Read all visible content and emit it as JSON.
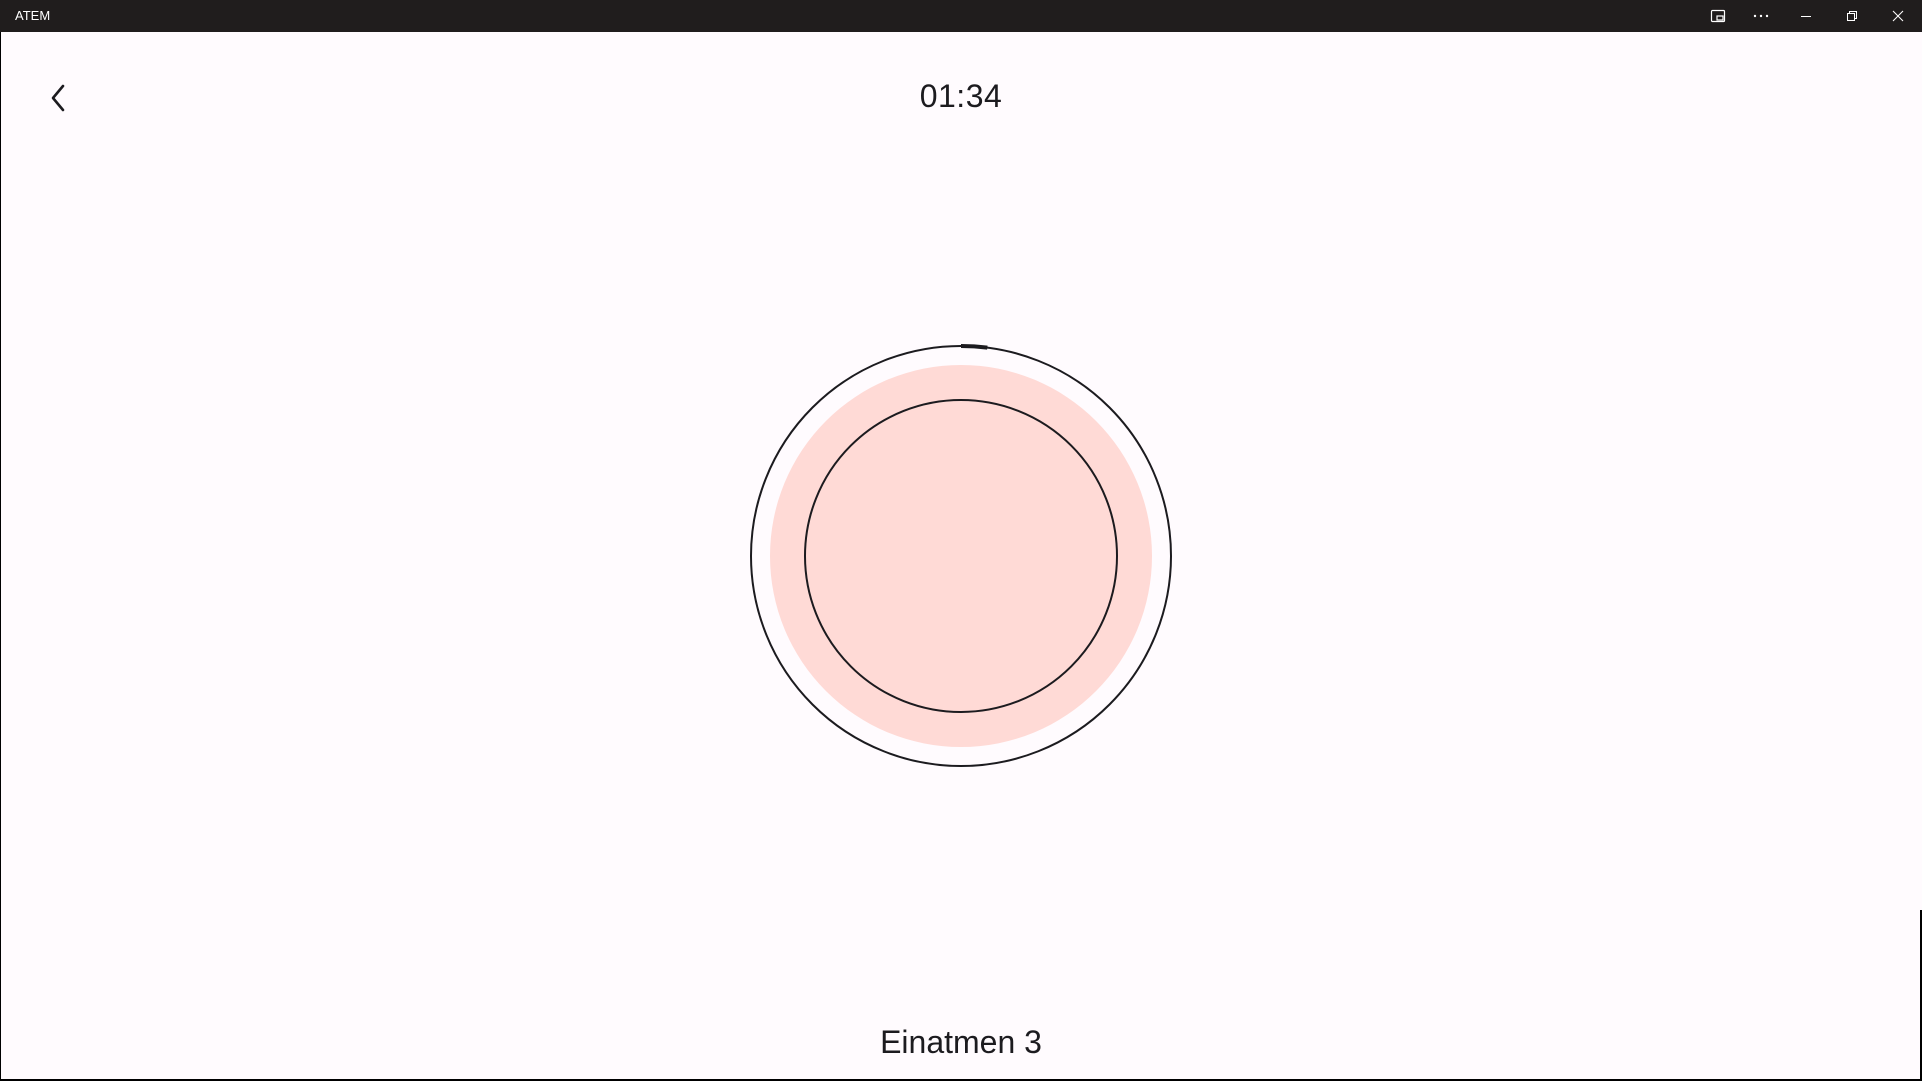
{
  "window": {
    "title": "ATEM",
    "controls": {
      "cast_icon": "cast-icon",
      "more_icon": "more-icon",
      "minimize_icon": "minimize-icon",
      "restore_icon": "restore-icon",
      "close_icon": "close-icon"
    }
  },
  "header": {
    "back_icon": "chevron-left-icon",
    "timer": "01:34"
  },
  "breathing": {
    "progress_fraction": 0.02,
    "colors": {
      "fill": "#ffdad6",
      "ring": "#1c1b1f",
      "background": "#fffbfe"
    }
  },
  "footer": {
    "phase": "Einatmen 3"
  }
}
